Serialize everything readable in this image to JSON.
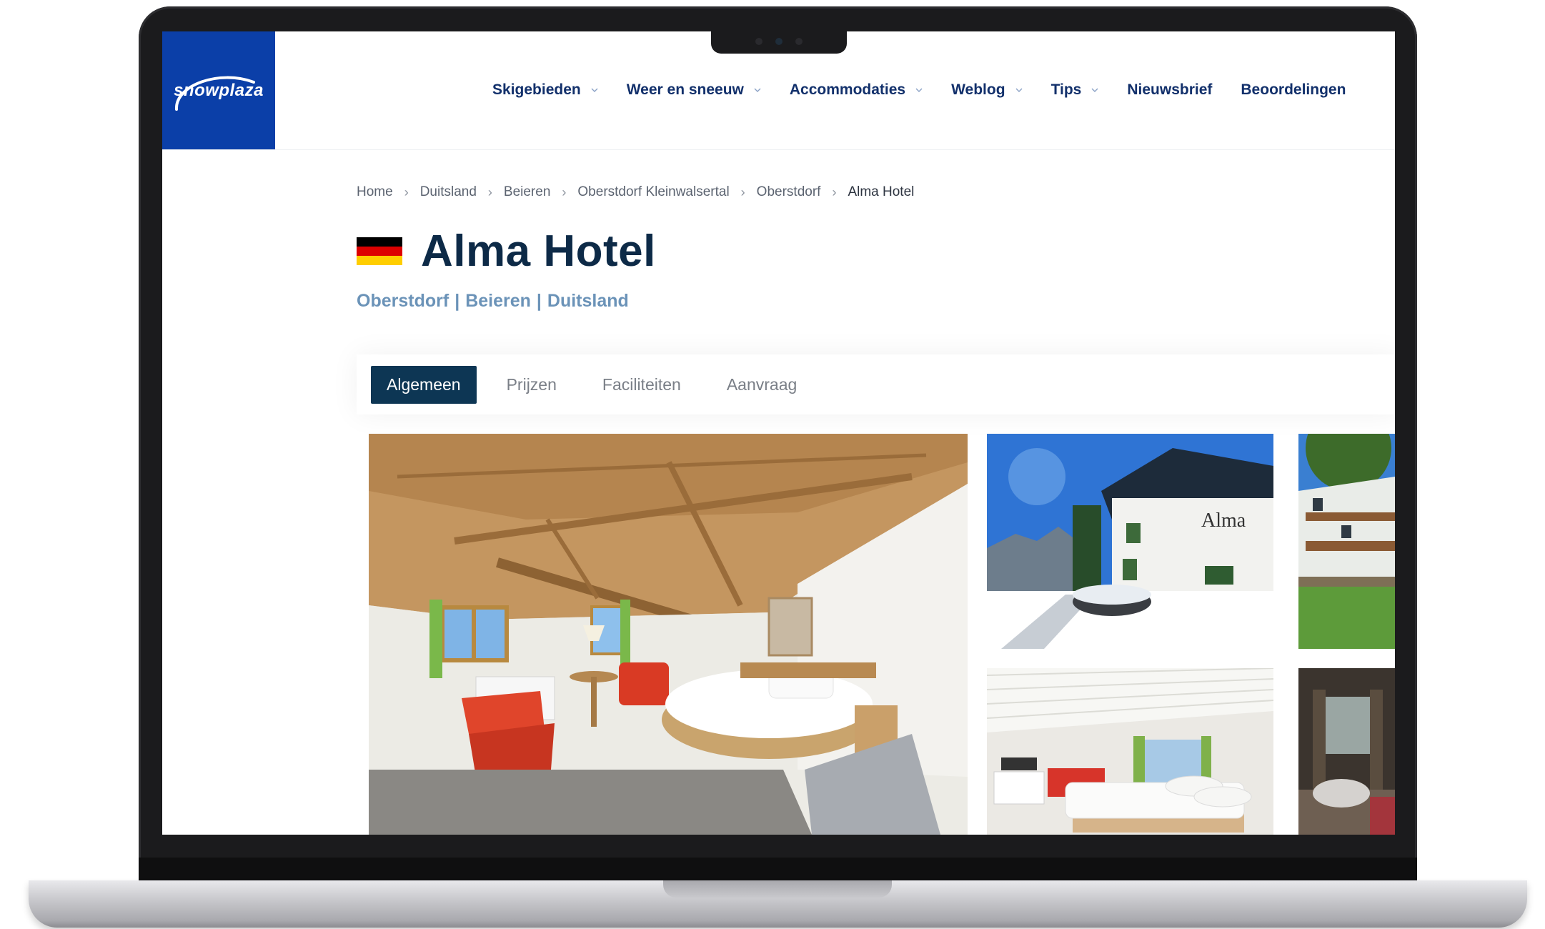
{
  "brand": {
    "logo_text": "snowplaza",
    "accent": "#0b3fa8",
    "nav_color": "#12306b",
    "tab_active_bg": "#0d3654"
  },
  "nav": {
    "items": [
      {
        "label": "Skigebieden",
        "dropdown": true
      },
      {
        "label": "Weer en sneeuw",
        "dropdown": true
      },
      {
        "label": "Accommodaties",
        "dropdown": true
      },
      {
        "label": "Weblog",
        "dropdown": true
      },
      {
        "label": "Tips",
        "dropdown": true
      },
      {
        "label": "Nieuwsbrief",
        "dropdown": false
      },
      {
        "label": "Beoordelingen",
        "dropdown": false
      }
    ]
  },
  "breadcrumb": [
    "Home",
    "Duitsland",
    "Beieren",
    "Oberstdorf Kleinwalsertal",
    "Oberstdorf",
    "Alma Hotel"
  ],
  "hotel": {
    "title": "Alma Hotel",
    "flag": "germany-flag",
    "location": {
      "town": "Oberstdorf",
      "region": "Beieren",
      "country": "Duitsland",
      "separator": "|"
    }
  },
  "tabs": [
    {
      "label": "Algemeen",
      "active": true
    },
    {
      "label": "Prijzen",
      "active": false
    },
    {
      "label": "Faciliteiten",
      "active": false
    },
    {
      "label": "Aanvraag",
      "active": false
    }
  ],
  "gallery": {
    "photos": [
      "room-photo",
      "hotel-exterior-winter-photo",
      "hotel-exterior-summer-photo",
      "double-room-photo",
      "interior-photo"
    ],
    "exterior_sign": "Alma"
  }
}
